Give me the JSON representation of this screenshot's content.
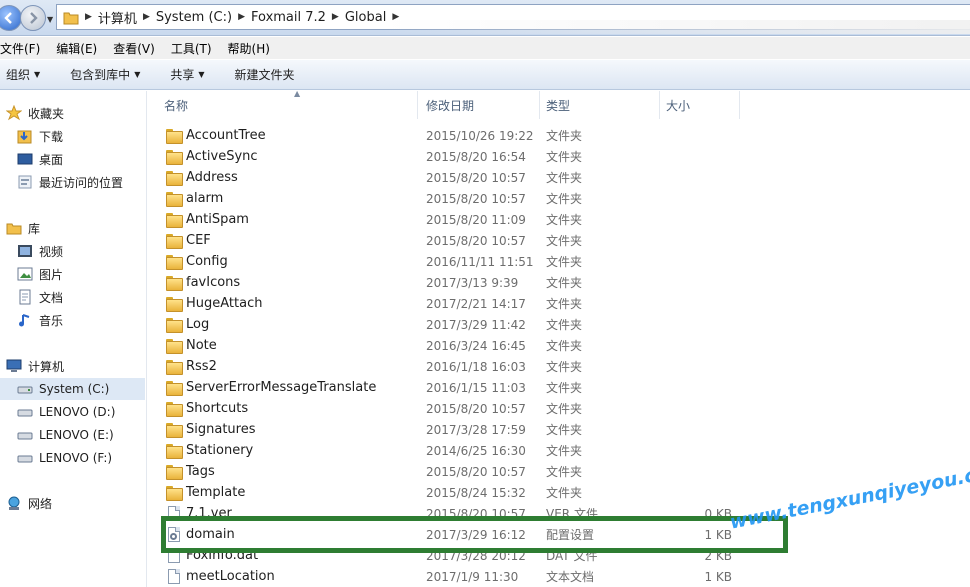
{
  "address": {
    "crumbs": [
      "计算机",
      "System (C:)",
      "Foxmail 7.2",
      "Global"
    ]
  },
  "menu": [
    "文件(F)",
    "编辑(E)",
    "查看(V)",
    "工具(T)",
    "帮助(H)"
  ],
  "toolbar": {
    "organize": "组织",
    "include_library": "包含到库中",
    "share": "共享",
    "new_folder": "新建文件夹"
  },
  "nav": {
    "favorites": "收藏夹",
    "downloads": "下载",
    "desktop": "桌面",
    "recent": "最近访问的位置",
    "libraries": "库",
    "videos": "视频",
    "pictures": "图片",
    "documents": "文档",
    "music": "音乐",
    "computer": "计算机",
    "drive_c": "System (C:)",
    "drive_d": "LENOVO (D:)",
    "drive_e": "LENOVO (E:)",
    "drive_f": "LENOVO (F:)",
    "network": "网络"
  },
  "columns": {
    "name": "名称",
    "date": "修改日期",
    "type": "类型",
    "size": "大小"
  },
  "files": [
    {
      "name": "AccountTree",
      "date": "2015/10/26 19:22",
      "type": "文件夹",
      "size": "",
      "kind": "folder"
    },
    {
      "name": "ActiveSync",
      "date": "2015/8/20 16:54",
      "type": "文件夹",
      "size": "",
      "kind": "folder"
    },
    {
      "name": "Address",
      "date": "2015/8/20 10:57",
      "type": "文件夹",
      "size": "",
      "kind": "folder"
    },
    {
      "name": "alarm",
      "date": "2015/8/20 10:57",
      "type": "文件夹",
      "size": "",
      "kind": "folder"
    },
    {
      "name": "AntiSpam",
      "date": "2015/8/20 11:09",
      "type": "文件夹",
      "size": "",
      "kind": "folder"
    },
    {
      "name": "CEF",
      "date": "2015/8/20 10:57",
      "type": "文件夹",
      "size": "",
      "kind": "folder"
    },
    {
      "name": "Config",
      "date": "2016/11/11 11:51",
      "type": "文件夹",
      "size": "",
      "kind": "folder"
    },
    {
      "name": "favIcons",
      "date": "2017/3/13 9:39",
      "type": "文件夹",
      "size": "",
      "kind": "folder"
    },
    {
      "name": "HugeAttach",
      "date": "2017/2/21 14:17",
      "type": "文件夹",
      "size": "",
      "kind": "folder"
    },
    {
      "name": "Log",
      "date": "2017/3/29 11:42",
      "type": "文件夹",
      "size": "",
      "kind": "folder"
    },
    {
      "name": "Note",
      "date": "2016/3/24 16:45",
      "type": "文件夹",
      "size": "",
      "kind": "folder"
    },
    {
      "name": "Rss2",
      "date": "2016/1/18 16:03",
      "type": "文件夹",
      "size": "",
      "kind": "folder"
    },
    {
      "name": "ServerErrorMessageTranslate",
      "date": "2016/1/15 11:03",
      "type": "文件夹",
      "size": "",
      "kind": "folder"
    },
    {
      "name": "Shortcuts",
      "date": "2015/8/20 10:57",
      "type": "文件夹",
      "size": "",
      "kind": "folder"
    },
    {
      "name": "Signatures",
      "date": "2017/3/28 17:59",
      "type": "文件夹",
      "size": "",
      "kind": "folder"
    },
    {
      "name": "Stationery",
      "date": "2014/6/25 16:30",
      "type": "文件夹",
      "size": "",
      "kind": "folder"
    },
    {
      "name": "Tags",
      "date": "2015/8/20 10:57",
      "type": "文件夹",
      "size": "",
      "kind": "folder"
    },
    {
      "name": "Template",
      "date": "2015/8/24 15:32",
      "type": "文件夹",
      "size": "",
      "kind": "folder"
    },
    {
      "name": "7.1.ver",
      "date": "2015/8/20 10:57",
      "type": "VER 文件",
      "size": "0 KB",
      "kind": "file"
    },
    {
      "name": "domain",
      "date": "2017/3/29 16:12",
      "type": "配置设置",
      "size": "1 KB",
      "kind": "config"
    },
    {
      "name": "FoxInfo.dat",
      "date": "2017/3/28 20:12",
      "type": "DAT 文件",
      "size": "2 KB",
      "kind": "file"
    },
    {
      "name": "meetLocation",
      "date": "2017/1/9 11:30",
      "type": "文本文档",
      "size": "1 KB",
      "kind": "file"
    }
  ],
  "watermark": "www.tengxunqiyeyou.com",
  "colors": {
    "highlight_border": "#2e7d32",
    "watermark": "#2196f3"
  }
}
